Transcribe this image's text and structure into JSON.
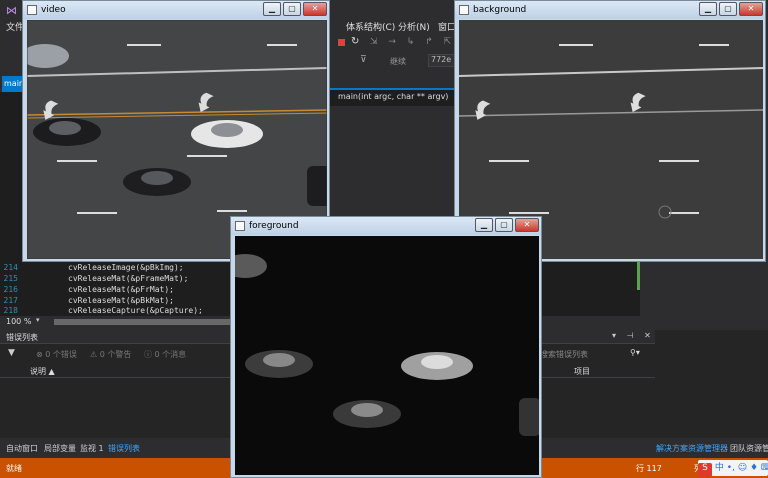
{
  "ide": {
    "menu": [
      "文件",
      "体系结构(C)",
      "分析(N)",
      "窗口"
    ],
    "toolbar_field": "772e",
    "toolbar_label": "继续",
    "tab_label": "main",
    "function_signature": "main(int argc, char ** argv)",
    "code_lines": [
      {
        "ln": "214",
        "text": "cvReleaseImage(&pBkImg);"
      },
      {
        "ln": "215",
        "text": "cvReleaseMat(&pFrameMat);"
      },
      {
        "ln": "216",
        "text": "cvReleaseMat(&pFrMat);"
      },
      {
        "ln": "217",
        "text": "cvReleaseMat(&pBkMat);"
      },
      {
        "ln": "218",
        "text": "cvReleaseCapture(&pCapture);"
      }
    ],
    "zoom": "100 %",
    "error_list": {
      "title": "错误列表",
      "errors": "0 个错误",
      "warnings": "0 个警告",
      "messages": "0 个消息",
      "col_description": "说明",
      "col_project": "项目",
      "search_placeholder": "搜索错误列表"
    },
    "bottom_tabs": [
      "自动窗口",
      "局部变量",
      "监视 1",
      "错误列表"
    ],
    "bottom_right_tabs": [
      "解决方案资源管理器",
      "团队资源管"
    ],
    "status": {
      "left": "就绪",
      "line": "行 117",
      "col": "列"
    }
  },
  "windows": {
    "video": {
      "title": "video"
    },
    "background": {
      "title": "background"
    },
    "foreground": {
      "title": "foreground"
    }
  },
  "colors": {
    "statusbar": "#ca5100",
    "accent": "#007acc",
    "ime": "#e0392b"
  }
}
